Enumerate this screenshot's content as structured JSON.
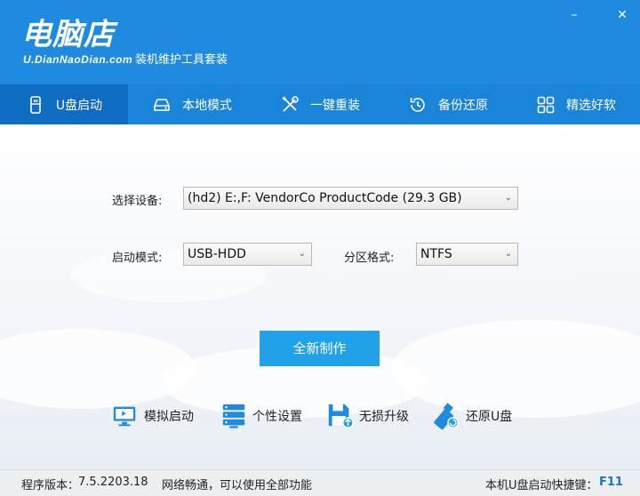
{
  "brand": {
    "name": "电脑店",
    "url": "U.DianNaoDian.com",
    "subtitle": "装机维护工具套装"
  },
  "window_controls": {
    "minimize": "–",
    "close": "✕"
  },
  "nav": {
    "items": [
      {
        "label": "U盘启动",
        "icon": "usb-drive-icon",
        "active": true
      },
      {
        "label": "本地模式",
        "icon": "hard-disk-icon",
        "active": false
      },
      {
        "label": "一键重装",
        "icon": "tools-icon",
        "active": false
      },
      {
        "label": "备份还原",
        "icon": "restore-clock-icon",
        "active": false
      },
      {
        "label": "精选好软",
        "icon": "apps-grid-icon",
        "active": false
      }
    ]
  },
  "form": {
    "device_label": "选择设备:",
    "device_value": "(hd2) E:,F: VendorCo ProductCode (29.3 GB)",
    "boot_mode_label": "启动模式:",
    "boot_mode_value": "USB-HDD",
    "partition_label": "分区格式:",
    "partition_value": "NTFS",
    "create_button": "全新制作"
  },
  "tools": [
    {
      "label": "模拟启动",
      "icon": "monitor-simulate-icon"
    },
    {
      "label": "个性设置",
      "icon": "server-settings-icon"
    },
    {
      "label": "无损升级",
      "icon": "floppy-upgrade-icon"
    },
    {
      "label": "还原U盘",
      "icon": "usb-restore-icon"
    }
  ],
  "status": {
    "version_label": "程序版本：",
    "version": "7.5.2203.18",
    "network": "网络畅通，可以使用全部功能",
    "hotkey_label": "本机U盘启动快捷键：",
    "hotkey": "F11"
  },
  "colors": {
    "header": "#1f8be0",
    "nav_active": "#0f6cc0",
    "button": "#21a2e8",
    "hotkey": "#1a73c9"
  }
}
